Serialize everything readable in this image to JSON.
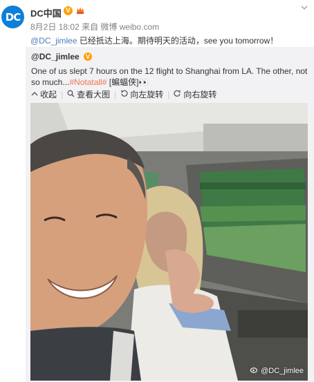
{
  "post": {
    "avatar_text": "DC",
    "username": "DC中国",
    "verified_symbol": "V",
    "date": "8月2日 18:02",
    "source_prefix": "来自",
    "source": "微博 weibo.com",
    "mention": "@DC_jimlee",
    "text": " 已经抵达上海。期待明天的活动，see you tomorrow！"
  },
  "repost": {
    "username": "@DC_jimlee",
    "verified_symbol": "V",
    "text_line1": "One of us slept 7 hours on the 12 flight to Shanghai from LA. The other, not",
    "text_line2_prefix": "so much...",
    "hashtag": "#Notatall#",
    "tag2": " [蝙蝠侠]",
    "emoji": "👀"
  },
  "toolbar": {
    "collapse": "收起",
    "view_large": "查看大图",
    "rotate_left": "向左旋转",
    "rotate_right": "向右旋转"
  },
  "photo": {
    "watermark": "@DC_jimlee"
  },
  "colors": {
    "accent_orange": "#eb7350",
    "repost_bg": "#f2f2f5",
    "avatar_blue": "#0d7fd9"
  }
}
